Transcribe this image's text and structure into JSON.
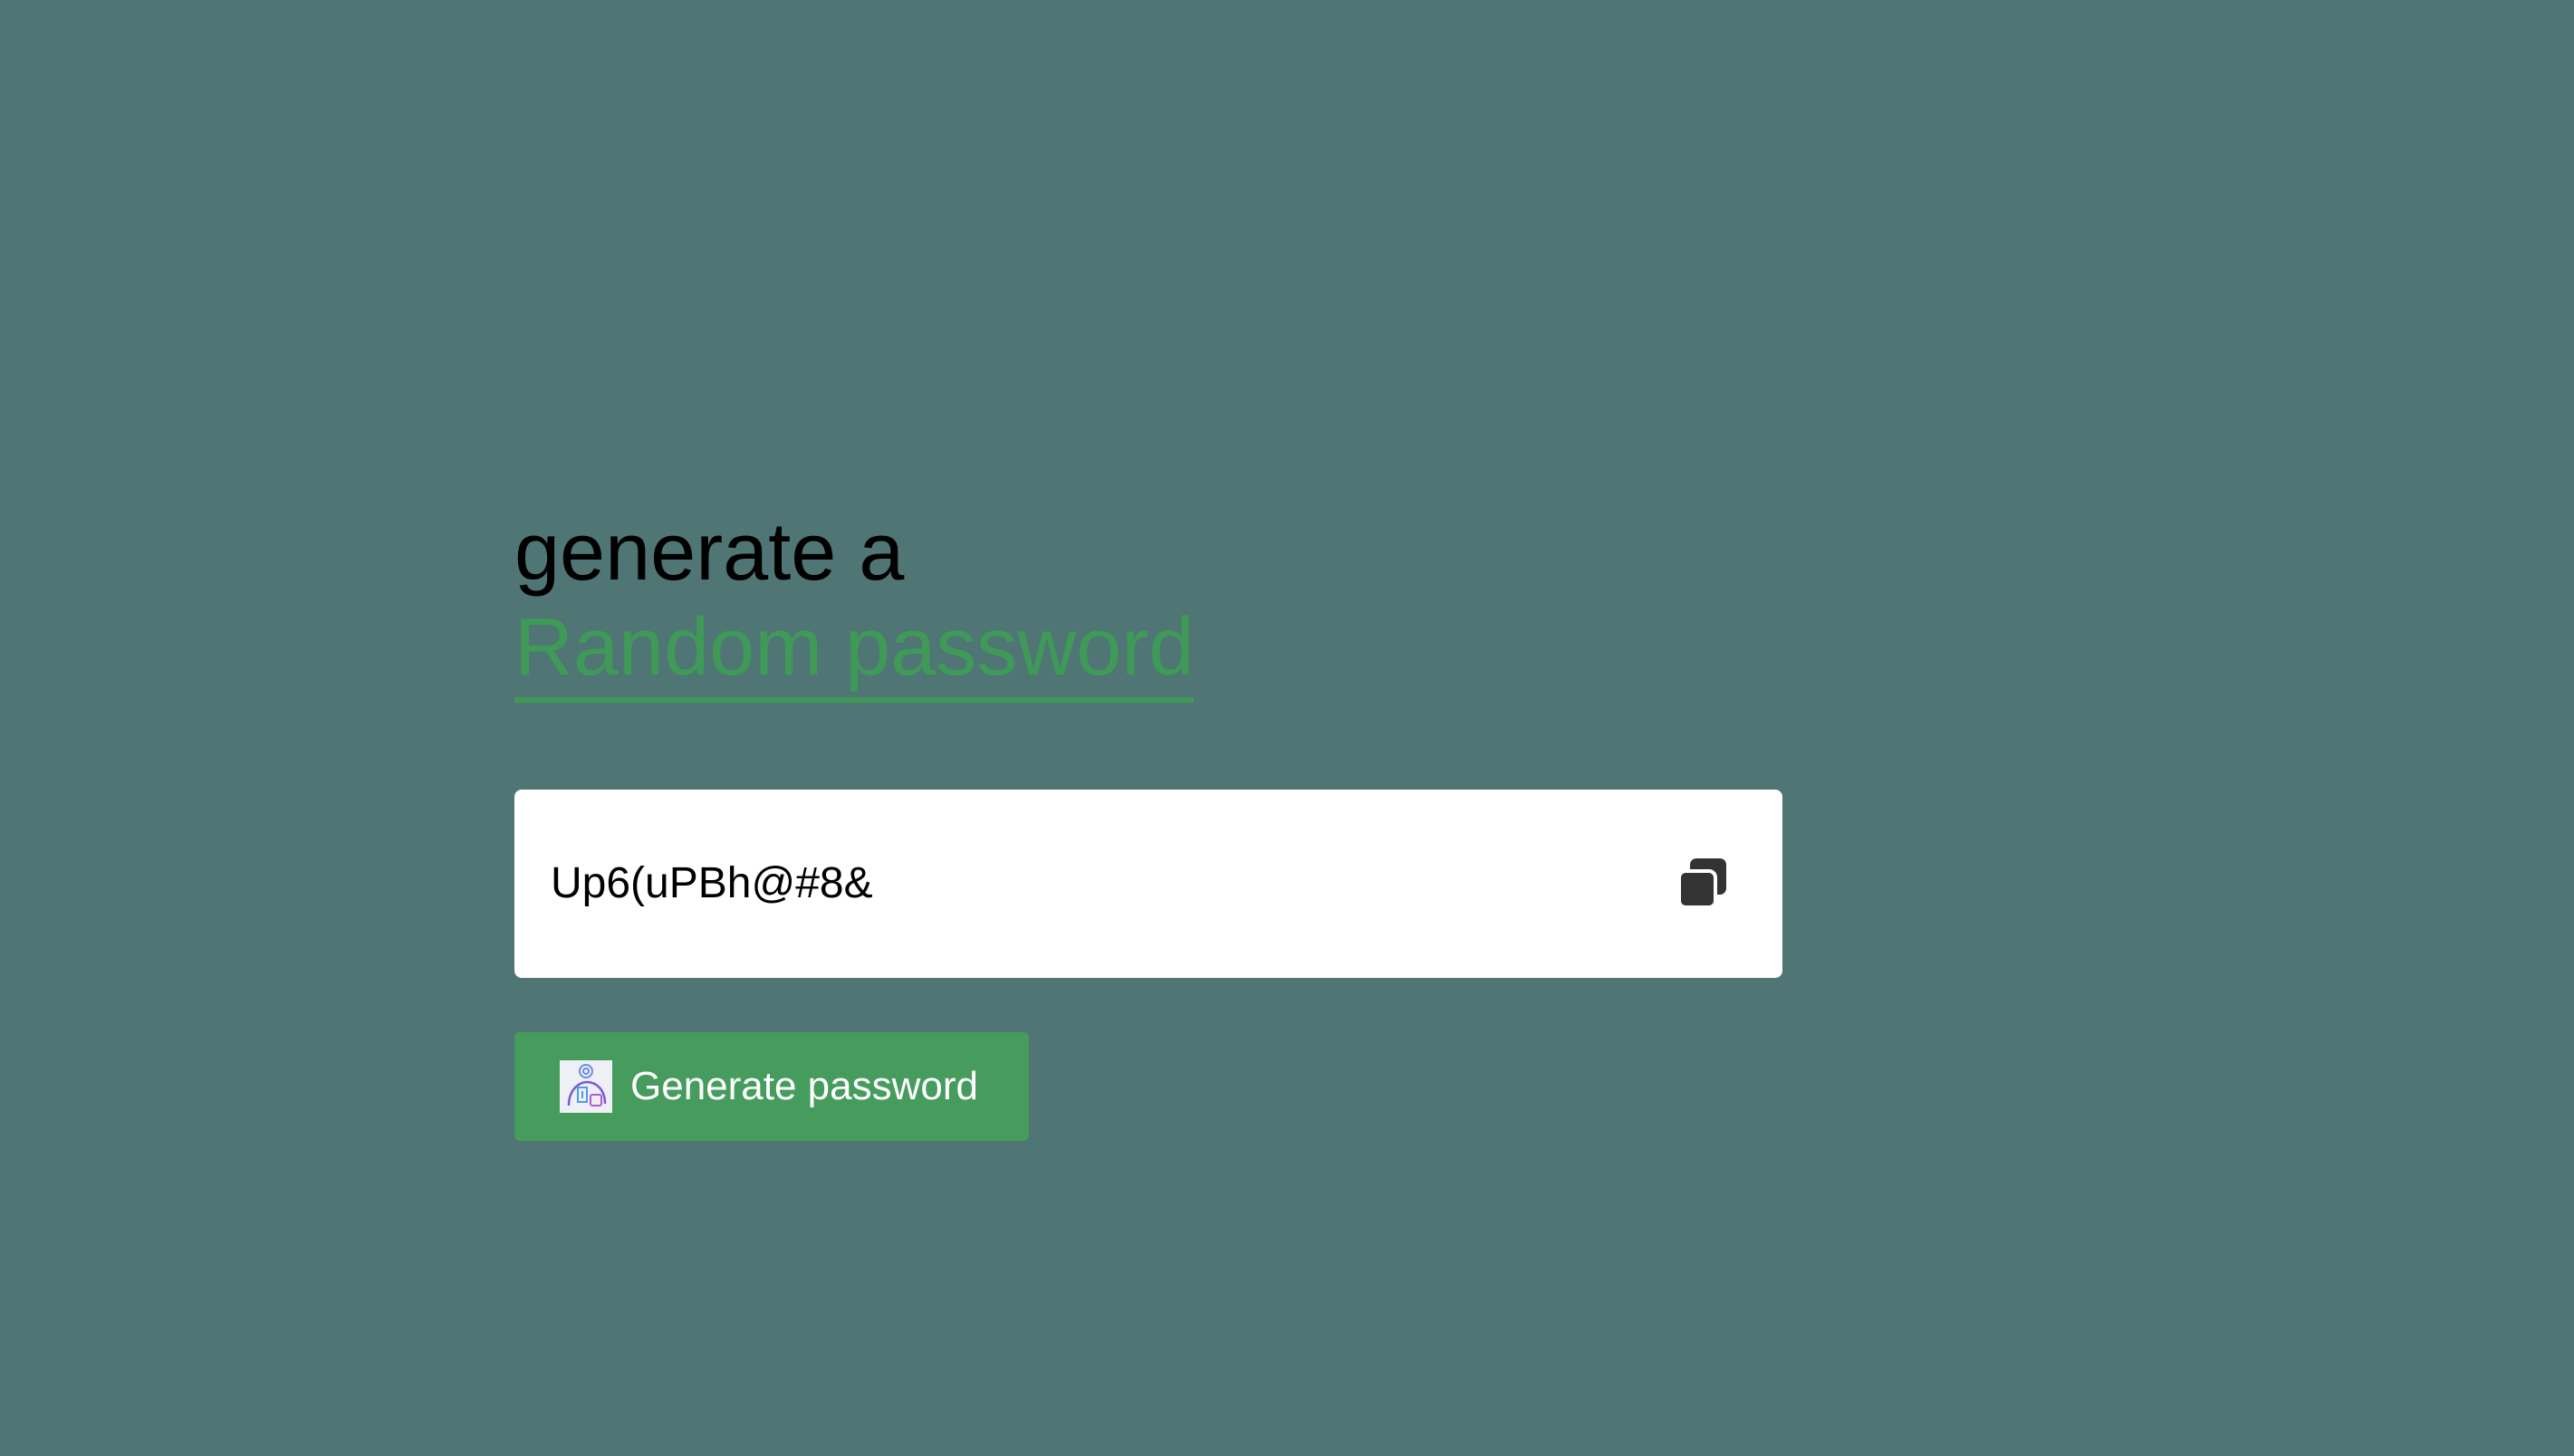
{
  "heading": {
    "line1": "generate a",
    "line2": "Random password"
  },
  "password": {
    "value": "Up6(uPBh@#8&",
    "copy_icon": "copy-icon"
  },
  "generate_button": {
    "label": "Generate password",
    "icon": "generate-illustration-icon"
  },
  "colors": {
    "background": "#4f7574",
    "accent": "#3f9a58",
    "button": "#469c5d",
    "box": "#ffffff"
  }
}
